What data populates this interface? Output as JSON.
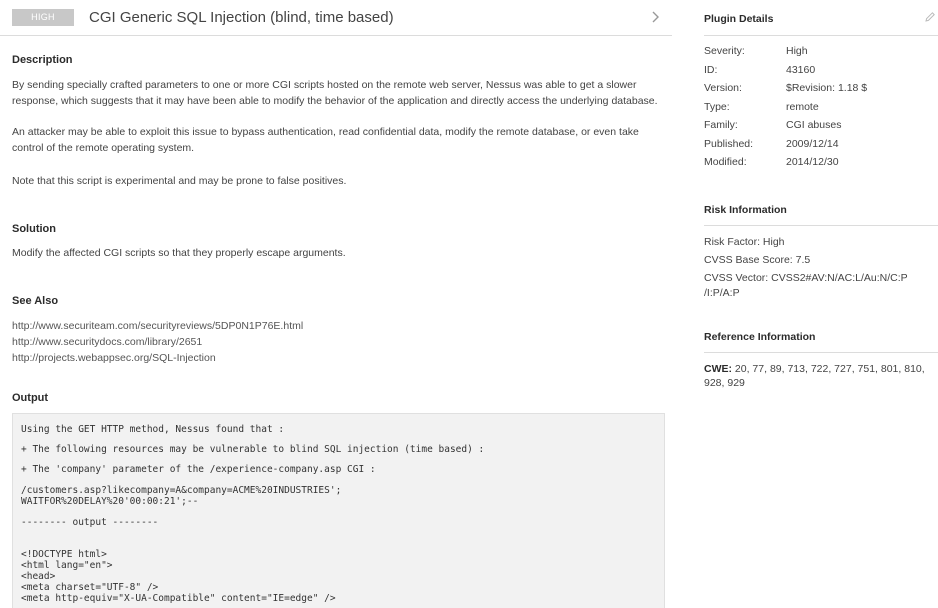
{
  "header": {
    "severity_badge": "HIGH",
    "title": "CGI Generic SQL Injection (blind, time based)"
  },
  "description": {
    "heading": "Description",
    "paragraphs": [
      "By sending specially crafted parameters to one or more CGI scripts hosted on the remote web server, Nessus was able to get a slower response, which suggests that it may have been able to modify the behavior of the application and directly access the underlying database.",
      "An attacker may be able to exploit this issue to bypass authentication, read confidential data, modify the remote database, or even take control of the remote operating system.",
      "Note that this script is experimental and may be prone to false positives."
    ]
  },
  "solution": {
    "heading": "Solution",
    "text": "Modify the affected CGI scripts so that they properly escape arguments."
  },
  "see_also": {
    "heading": "See Also",
    "links": [
      "http://www.securiteam.com/securityreviews/5DP0N1P76E.html",
      "http://www.securitydocs.com/library/2651",
      "http://projects.webappsec.org/SQL-Injection"
    ]
  },
  "output": {
    "heading": "Output",
    "lines": [
      "Using the GET HTTP method, Nessus found that :",
      "+ The following resources may be vulnerable to blind SQL injection (time based) :",
      "+ The 'company' parameter of the /experience-company.asp CGI :",
      "/customers.asp?likecompany=A&company=ACME%20INDUSTRIES';",
      "WAITFOR%20DELAY%20'00:00:21';--",
      "-------- output --------",
      "<!DOCTYPE html>",
      "<html lang=\"en\">",
      "<head>",
      "<meta charset=\"UTF-8\" />",
      "<meta http-equiv=\"X-UA-Compatible\" content=\"IE=edge\" />"
    ]
  },
  "plugin_details": {
    "heading": "Plugin Details",
    "rows": [
      {
        "label": "Severity:",
        "value": "High"
      },
      {
        "label": "ID:",
        "value": "43160"
      },
      {
        "label": "Version:",
        "value": "$Revision: 1.18 $"
      },
      {
        "label": "Type:",
        "value": "remote"
      },
      {
        "label": "Family:",
        "value": "CGI abuses"
      },
      {
        "label": "Published:",
        "value": "2009/12/14"
      },
      {
        "label": "Modified:",
        "value": "2014/12/30"
      }
    ]
  },
  "risk_information": {
    "heading": "Risk Information",
    "risk_factor": "Risk Factor:  High",
    "cvss_base_score": "CVSS Base Score:  7.5",
    "cvss_vector_line1": "CVSS Vector:  CVSS2#AV:N/AC:L/Au:N/C:P",
    "cvss_vector_line2": "/I:P/A:P"
  },
  "reference_information": {
    "heading": "Reference Information",
    "cwe_label": "CWE:",
    "cwe_values": "20, 77, 89, 713, 722, 727, 751, 801, 810, 928, 929"
  },
  "icons": {
    "chevron": "chevron-right-icon",
    "edit": "pencil-icon"
  },
  "colors": {
    "badge_bg": "#c8c8c8",
    "output_bg": "#f2f2f2",
    "divider": "#dcdcdc"
  }
}
